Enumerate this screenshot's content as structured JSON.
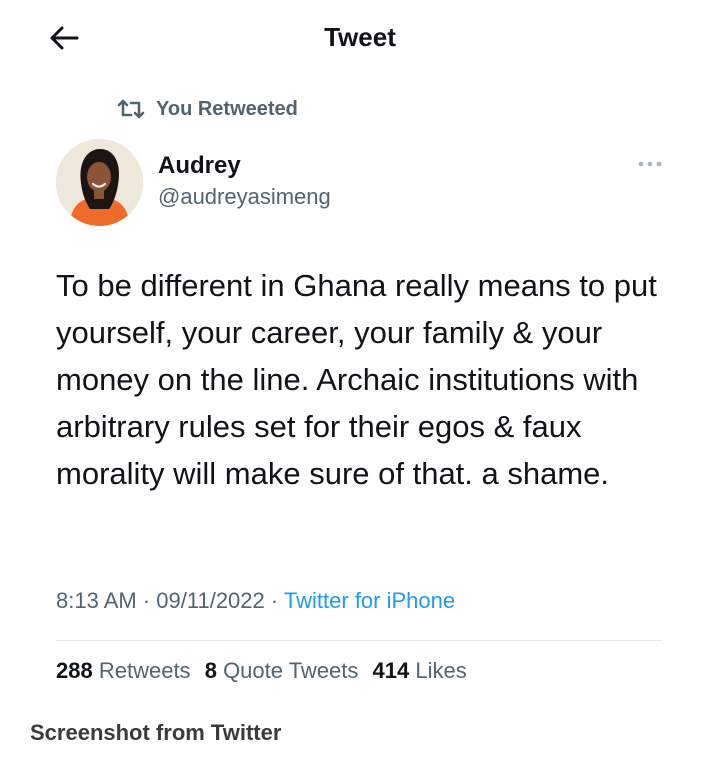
{
  "header": {
    "title": "Tweet",
    "back_icon": "arrow-left-icon"
  },
  "social_context": {
    "icon": "retweet-icon",
    "label": "You Retweeted"
  },
  "author": {
    "name": "Audrey",
    "handle": "@audreyasimeng",
    "avatar": "profile-photo"
  },
  "more_icon": "more-horizontal-icon",
  "tweet": {
    "text": "To be different in Ghana really means to put yourself, your career, your family & your money on the line. Archaic institutions with arbitrary rules set for their egos & faux morality will make sure of that. a shame."
  },
  "meta": {
    "time": "8:13 AM",
    "sep1": " · ",
    "date": "09/11/2022",
    "sep2": " · ",
    "source": "Twitter for iPhone"
  },
  "stats": {
    "retweets_count": "288",
    "retweets_label": "Retweets",
    "quotes_count": "8",
    "quotes_label": "Quote Tweets",
    "likes_count": "414",
    "likes_label": "Likes"
  },
  "caption": "Screenshot from Twitter",
  "colors": {
    "text": "#0f1419",
    "secondary": "#536471",
    "link": "#1d9bf0",
    "divider": "#e6e9ec"
  }
}
